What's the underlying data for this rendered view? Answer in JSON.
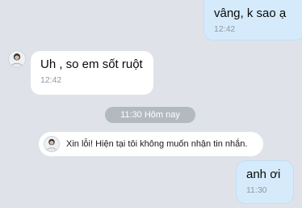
{
  "messages": [
    {
      "direction": "outgoing",
      "text": "vâng, k sao ạ",
      "time": "12:42"
    },
    {
      "direction": "incoming",
      "text": "Uh , so em sốt ruột",
      "time": "12:42",
      "avatar_icon": "user-avatar-icon"
    },
    {
      "direction": "outgoing",
      "text": "anh ơi",
      "time": "11:30"
    }
  ],
  "date_separator": "11:30 Hôm nay",
  "system_notice": {
    "text": "Xin lỗi! Hiện tại tôi không muốn nhận tin nhắn.",
    "avatar_icon": "user-avatar-icon"
  },
  "colors": {
    "background": "#dfe3e9",
    "outgoing_bubble": "#d5ebfc",
    "incoming_bubble": "#ffffff",
    "timestamp": "#8e98a3",
    "separator_pill": "#b3b9c1"
  }
}
